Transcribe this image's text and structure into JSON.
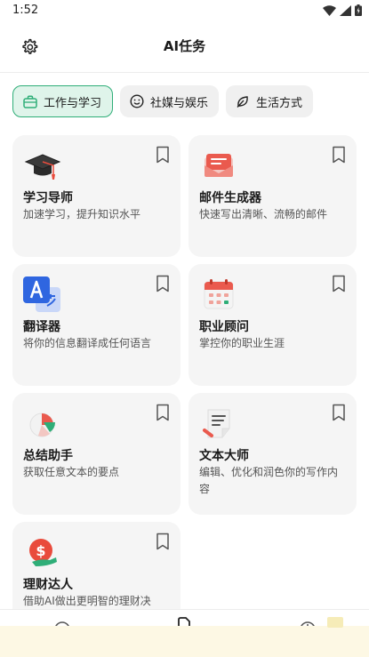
{
  "status_bar": {
    "time": "1:52"
  },
  "header": {
    "title": "AI任务",
    "settings_icon": "gear-icon"
  },
  "tabs": [
    {
      "label": "工作与学习",
      "icon": "briefcase-icon",
      "active": true
    },
    {
      "label": "社媒与娱乐",
      "icon": "smiley-icon",
      "active": false
    },
    {
      "label": "生活方式",
      "icon": "leaf-icon",
      "active": false
    }
  ],
  "cards": [
    {
      "title": "学习导师",
      "desc": "加速学习，提升知识水平",
      "icon": "graduation-cap-icon"
    },
    {
      "title": "邮件生成器",
      "desc": "快速写出清晰、流畅的邮件",
      "icon": "mail-icon"
    },
    {
      "title": "翻译器",
      "desc": "将你的信息翻译成任何语言",
      "icon": "translate-icon"
    },
    {
      "title": "职业顾问",
      "desc": "掌控你的职业生涯",
      "icon": "calendar-icon"
    },
    {
      "title": "总结助手",
      "desc": "获取任意文本的要点",
      "icon": "pie-chart-icon"
    },
    {
      "title": "文本大师",
      "desc": "编辑、优化和润色你的写作内容",
      "icon": "document-pen-icon"
    },
    {
      "title": "理财达人",
      "desc": "借助AI做出更明智的理财决",
      "icon": "money-bag-icon"
    }
  ],
  "colors": {
    "accent": "#2fae78",
    "tab_active_bg": "#dff4ea",
    "card_bg": "#f5f5f5"
  }
}
